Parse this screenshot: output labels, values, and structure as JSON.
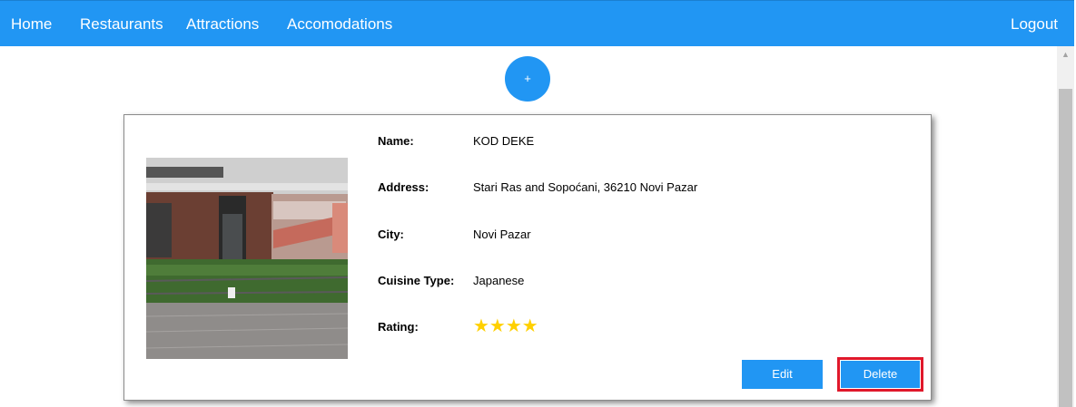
{
  "nav": {
    "home": "Home",
    "restaurants": "Restaurants",
    "attractions": "Attractions",
    "accomodations": "Accomodations",
    "logout": "Logout"
  },
  "add_button_label": "+",
  "restaurant": {
    "name_label": "Name:",
    "name": "KOD DEKE",
    "address_label": "Address:",
    "address": "Stari Ras and Sopoćani, 36210 Novi Pazar",
    "city_label": "City:",
    "city": "Novi Pazar",
    "cuisine_label": "Cuisine Type:",
    "cuisine": "Japanese",
    "rating_label": "Rating:",
    "rating": 4,
    "rating_stars": "★★★★"
  },
  "actions": {
    "edit": "Edit",
    "delete": "Delete"
  },
  "colors": {
    "primary": "#2196f3",
    "star": "#ffd000",
    "highlight": "#e0182b"
  }
}
